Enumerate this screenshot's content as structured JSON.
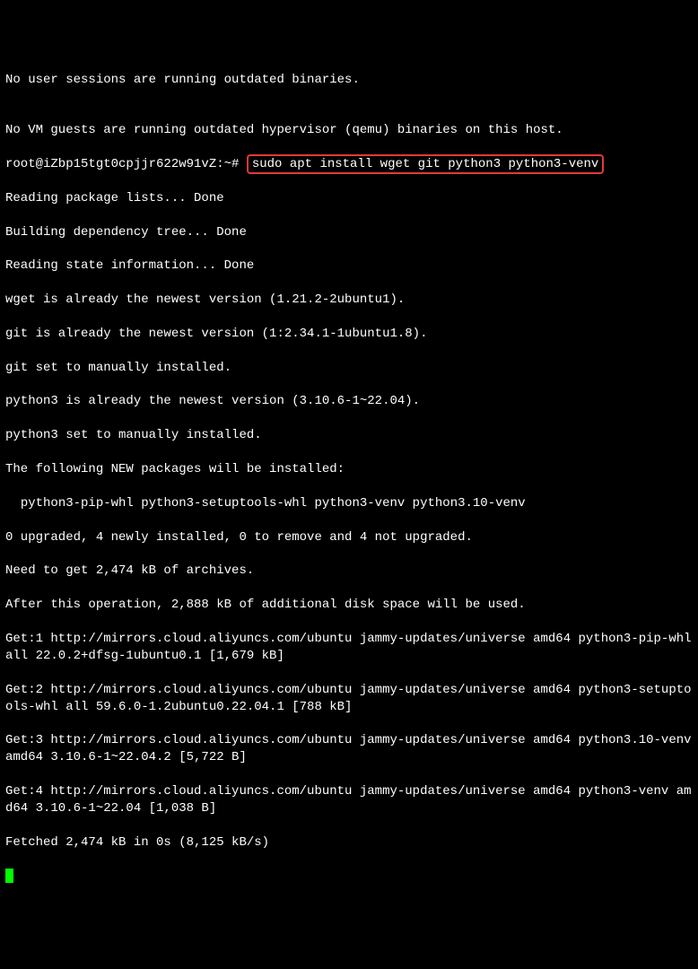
{
  "lines": {
    "l1": "No user sessions are running outdated binaries.",
    "l2": "",
    "l3": "No VM guests are running outdated hypervisor (qemu) binaries on this host.",
    "prompt": "root@iZbp15tgt0cpjjr622w91vZ:~# ",
    "cmd": "sudo apt install wget git python3 python3-venv",
    "l5": "Reading package lists... Done",
    "l6": "Building dependency tree... Done",
    "l7": "Reading state information... Done",
    "l8": "wget is already the newest version (1.21.2-2ubuntu1).",
    "l9": "git is already the newest version (1:2.34.1-1ubuntu1.8).",
    "l10": "git set to manually installed.",
    "l11": "python3 is already the newest version (3.10.6-1~22.04).",
    "l12": "python3 set to manually installed.",
    "l13": "The following NEW packages will be installed:",
    "l14": "  python3-pip-whl python3-setuptools-whl python3-venv python3.10-venv",
    "l15": "0 upgraded, 4 newly installed, 0 to remove and 4 not upgraded.",
    "l16": "Need to get 2,474 kB of archives.",
    "l17": "After this operation, 2,888 kB of additional disk space will be used.",
    "l18": "Get:1 http://mirrors.cloud.aliyuncs.com/ubuntu jammy-updates/universe amd64 python3-pip-whl all 22.0.2+dfsg-1ubuntu0.1 [1,679 kB]",
    "l19": "Get:2 http://mirrors.cloud.aliyuncs.com/ubuntu jammy-updates/universe amd64 python3-setuptools-whl all 59.6.0-1.2ubuntu0.22.04.1 [788 kB]",
    "l20": "Get:3 http://mirrors.cloud.aliyuncs.com/ubuntu jammy-updates/universe amd64 python3.10-venv amd64 3.10.6-1~22.04.2 [5,722 B]",
    "l21": "Get:4 http://mirrors.cloud.aliyuncs.com/ubuntu jammy-updates/universe amd64 python3-venv amd64 3.10.6-1~22.04 [1,038 B]",
    "l22": "Fetched 2,474 kB in 0s (8,125 kB/s)"
  }
}
